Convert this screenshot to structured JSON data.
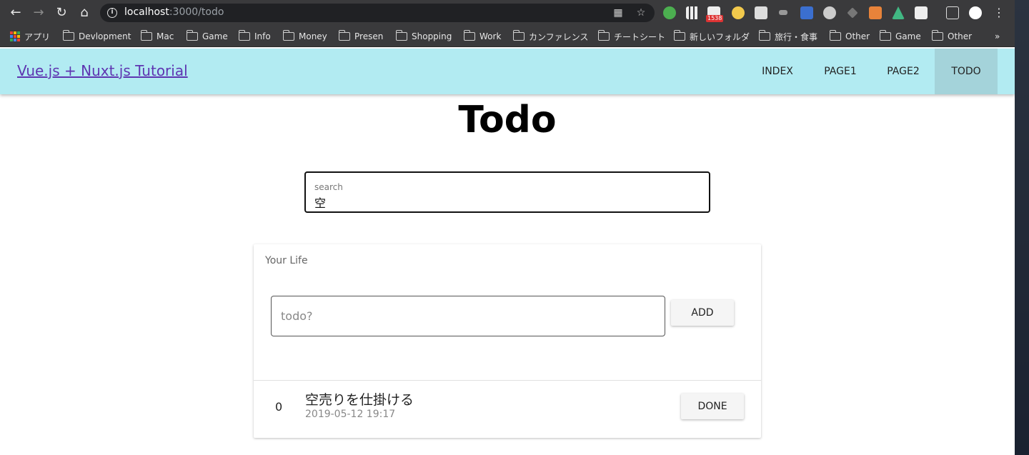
{
  "browser": {
    "url_host": "localhost",
    "url_path": ":3000/todo",
    "mail_badge": "1538",
    "bookmarks": [
      {
        "label": "アプリ",
        "type": "apps"
      },
      {
        "label": "Devlopment",
        "type": "folder"
      },
      {
        "label": "Mac",
        "type": "folder"
      },
      {
        "label": "Game",
        "type": "folder"
      },
      {
        "label": "Info",
        "type": "folder"
      },
      {
        "label": "Money",
        "type": "folder"
      },
      {
        "label": "Presen",
        "type": "folder"
      },
      {
        "label": "Shopping",
        "type": "folder"
      },
      {
        "label": "Work",
        "type": "folder"
      },
      {
        "label": "カンファレンス",
        "type": "folder"
      },
      {
        "label": "チートシート",
        "type": "folder"
      },
      {
        "label": "新しいフォルダ",
        "type": "folder"
      },
      {
        "label": "旅行・食事",
        "type": "folder"
      },
      {
        "label": "Other",
        "type": "folder"
      },
      {
        "label": "Game",
        "type": "folder"
      },
      {
        "label": "Other",
        "type": "folder"
      }
    ],
    "overflow": "»"
  },
  "app": {
    "title": "Vue.js + Nuxt.js Tutorial",
    "nav": [
      {
        "label": "INDEX",
        "active": false
      },
      {
        "label": "PAGE1",
        "active": false
      },
      {
        "label": "PAGE2",
        "active": false
      },
      {
        "label": "TODO",
        "active": true
      }
    ],
    "accent_color": "#b2ebf2"
  },
  "page": {
    "title": "Todo",
    "search": {
      "label": "search",
      "value": "空"
    },
    "card": {
      "subtitle": "Your Life",
      "todo_placeholder": "todo?",
      "add_label": "ADD",
      "items": [
        {
          "index": "0",
          "title": "空売りを仕掛ける",
          "date": "2019-05-12 19:17",
          "done_label": "DONE"
        }
      ]
    }
  }
}
